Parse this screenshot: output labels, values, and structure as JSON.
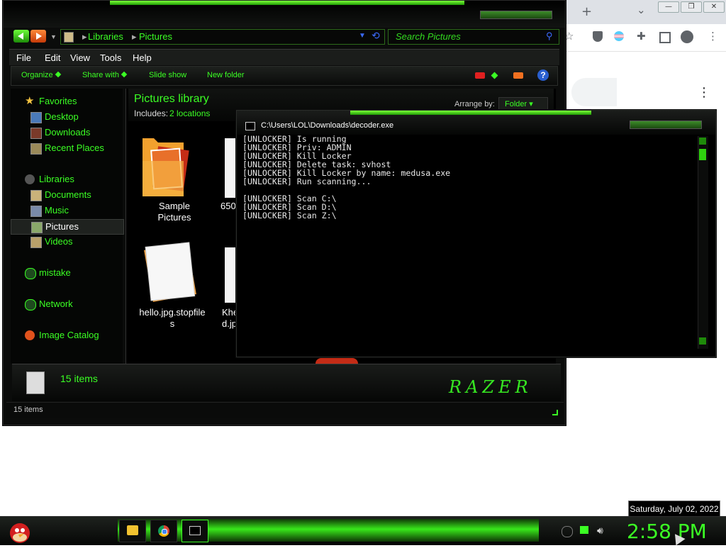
{
  "chrome": {
    "new_tab": "+",
    "tab_chevron": "⌄",
    "win_min": "—",
    "win_max": "❐",
    "win_close": "✕",
    "menu_dots": "⋮"
  },
  "explorer": {
    "breadcrumb": [
      "Libraries",
      "Pictures"
    ],
    "search_placeholder": "Search Pictures",
    "menu": [
      "File",
      "Edit",
      "View",
      "Tools",
      "Help"
    ],
    "commands": [
      "Organize",
      "Share with",
      "Slide show",
      "New folder"
    ],
    "help": "?",
    "nav": {
      "favorites": "Favorites",
      "desktop": "Desktop",
      "downloads": "Downloads",
      "recent": "Recent Places",
      "libraries": "Libraries",
      "documents": "Documents",
      "music": "Music",
      "pictures": "Pictures",
      "videos": "Videos",
      "mistake": "mistake",
      "network": "Network",
      "image_catalog": "Image Catalog"
    },
    "library_title": "Pictures library",
    "includes_label": "Includes:",
    "includes_value": "2 locations",
    "arrange_label": "Arrange by:",
    "arrange_value": "Folder",
    "items": [
      {
        "name": "Sample\nPictures"
      },
      {
        "name": "650"
      },
      {
        "name": "hello.jpg.stopfile\ns"
      },
      {
        "name": "Khe\nd.jp"
      }
    ],
    "details_count": "15 items",
    "status_count": "15 items",
    "brand": "RAZER"
  },
  "console": {
    "title": "C:\\Users\\LOL\\Downloads\\decoder.exe",
    "lines": [
      "[UNLOCKER] Is running",
      "[UNLOCKER] Priv: ADMIN",
      "[UNLOCKER] Kill Locker",
      "[UNLOCKER] Delete task: svhost",
      "[UNLOCKER] Kill Locker by name: medusa.exe",
      "[UNLOCKER] Run scanning...",
      "",
      "[UNLOCKER] Scan C:\\",
      "[UNLOCKER] Scan D:\\",
      "[UNLOCKER] Scan Z:\\"
    ]
  },
  "taskbar": {
    "date_tooltip": "Saturday, July 02, 2022",
    "clock": "2:58 PM"
  },
  "colors": {
    "accent": "#3bff24",
    "background": "#000000"
  }
}
